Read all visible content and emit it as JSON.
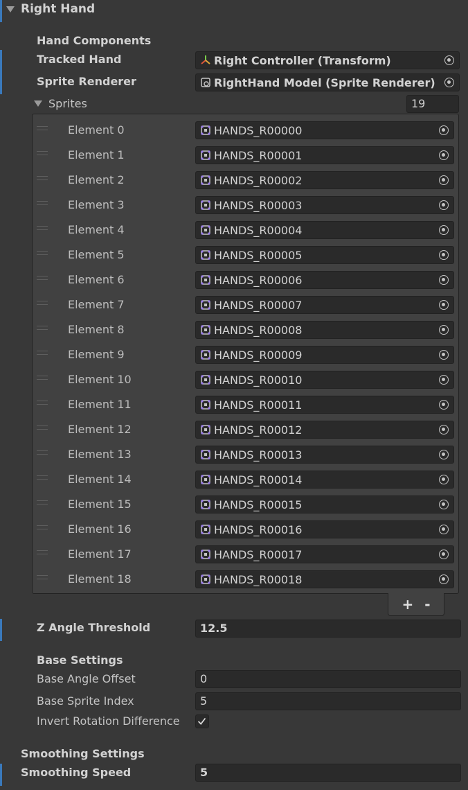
{
  "section": {
    "title": "Right Hand"
  },
  "hand_components": {
    "header": "Hand Components",
    "tracked_hand": {
      "label": "Tracked Hand",
      "value": "Right Controller (Transform)"
    },
    "sprite_renderer": {
      "label": "Sprite Renderer",
      "value": "RightHand Model (Sprite Renderer)"
    }
  },
  "sprites": {
    "label": "Sprites",
    "count": "19",
    "elements": [
      {
        "label": "Element 0",
        "value": "HANDS_R00000"
      },
      {
        "label": "Element 1",
        "value": "HANDS_R00001"
      },
      {
        "label": "Element 2",
        "value": "HANDS_R00002"
      },
      {
        "label": "Element 3",
        "value": "HANDS_R00003"
      },
      {
        "label": "Element 4",
        "value": "HANDS_R00004"
      },
      {
        "label": "Element 5",
        "value": "HANDS_R00005"
      },
      {
        "label": "Element 6",
        "value": "HANDS_R00006"
      },
      {
        "label": "Element 7",
        "value": "HANDS_R00007"
      },
      {
        "label": "Element 8",
        "value": "HANDS_R00008"
      },
      {
        "label": "Element 9",
        "value": "HANDS_R00009"
      },
      {
        "label": "Element 10",
        "value": "HANDS_R00010"
      },
      {
        "label": "Element 11",
        "value": "HANDS_R00011"
      },
      {
        "label": "Element 12",
        "value": "HANDS_R00012"
      },
      {
        "label": "Element 13",
        "value": "HANDS_R00013"
      },
      {
        "label": "Element 14",
        "value": "HANDS_R00014"
      },
      {
        "label": "Element 15",
        "value": "HANDS_R00015"
      },
      {
        "label": "Element 16",
        "value": "HANDS_R00016"
      },
      {
        "label": "Element 17",
        "value": "HANDS_R00017"
      },
      {
        "label": "Element 18",
        "value": "HANDS_R00018"
      }
    ],
    "add_label": "+",
    "remove_label": "-"
  },
  "z_angle_threshold": {
    "label": "Z Angle Threshold",
    "value": "12.5"
  },
  "base_settings": {
    "header": "Base Settings",
    "base_angle_offset": {
      "label": "Base Angle Offset",
      "value": "0"
    },
    "base_sprite_index": {
      "label": "Base Sprite Index",
      "value": "5"
    },
    "invert_rotation": {
      "label": "Invert Rotation Difference",
      "checked": true
    }
  },
  "smoothing_settings": {
    "header": "Smoothing Settings",
    "smoothing_speed": {
      "label": "Smoothing Speed",
      "value": "5"
    }
  },
  "colors": {
    "background": "#383838",
    "field": "#2a2a2a",
    "accent": "#3a79bb",
    "list_background": "#414141"
  }
}
